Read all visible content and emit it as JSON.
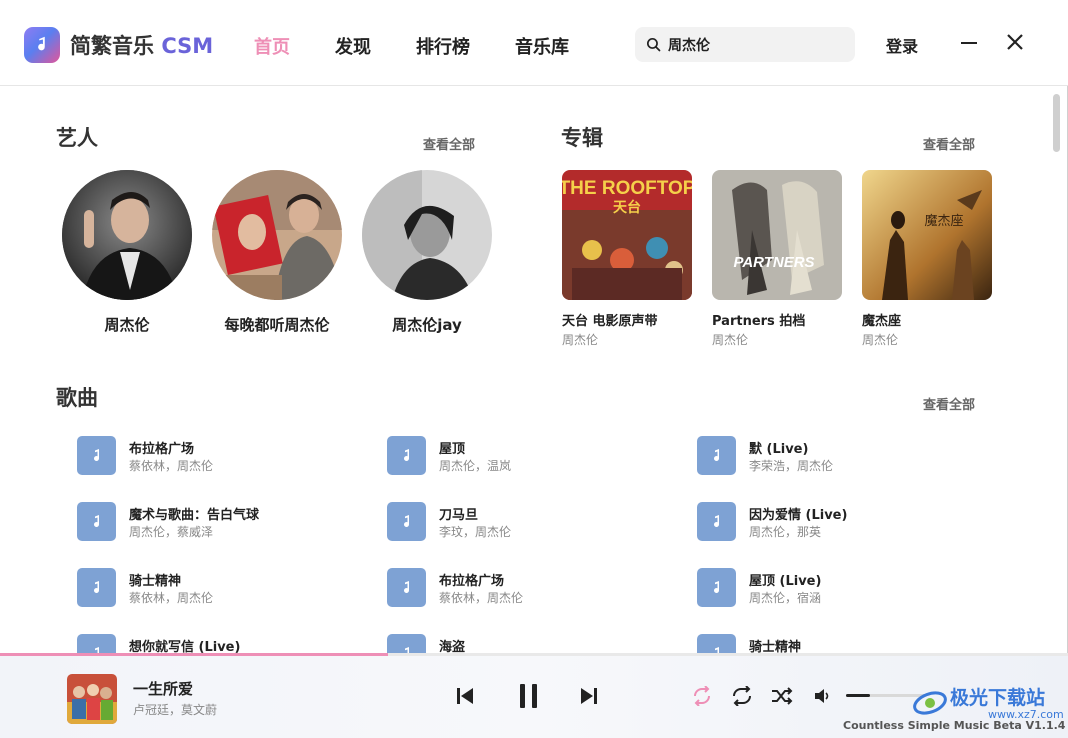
{
  "app": {
    "title_main": "简繁音乐",
    "title_suffix": "CSM"
  },
  "nav": {
    "items": [
      "首页",
      "发现",
      "排行榜",
      "音乐库"
    ],
    "active": 0
  },
  "search": {
    "value": "周杰伦",
    "icon": "search-icon"
  },
  "header": {
    "login": "登录"
  },
  "sections": {
    "artists": {
      "title": "艺人",
      "see_all": "查看全部",
      "items": [
        {
          "name": "周杰伦"
        },
        {
          "name": "每晚都听周杰伦"
        },
        {
          "name": "周杰伦jay"
        }
      ]
    },
    "albums": {
      "title": "专辑",
      "see_all": "查看全部",
      "items": [
        {
          "name": "天台 电影原声带",
          "artist": "周杰伦",
          "cover_text": "THE ROOFTOP"
        },
        {
          "name": "Partners 拍档",
          "artist": "周杰伦",
          "cover_text": "PARTNERS"
        },
        {
          "name": "魔杰座",
          "artist": "周杰伦",
          "cover_text": "魔杰座"
        }
      ]
    },
    "songs": {
      "title": "歌曲",
      "see_all": "查看全部",
      "items": [
        {
          "title": "布拉格广场",
          "artist": "蔡依林，周杰伦"
        },
        {
          "title": "屋顶",
          "artist": "周杰伦，温岚"
        },
        {
          "title": "默 (Live)",
          "artist": "李荣浩，周杰伦"
        },
        {
          "title": "魔术与歌曲：告白气球",
          "artist": "周杰伦，蔡威泽"
        },
        {
          "title": "刀马旦",
          "artist": "李玟，周杰伦"
        },
        {
          "title": "因为爱情 (Live)",
          "artist": "周杰伦，那英"
        },
        {
          "title": "骑士精神",
          "artist": "蔡依林，周杰伦"
        },
        {
          "title": "布拉格广场",
          "artist": "蔡依林，周杰伦"
        },
        {
          "title": "屋顶 (Live)",
          "artist": "周杰伦，宿涵"
        },
        {
          "title": "想你就写信 (Live)",
          "artist": ""
        },
        {
          "title": "海盗",
          "artist": ""
        },
        {
          "title": "骑士精神",
          "artist": ""
        }
      ]
    }
  },
  "player": {
    "title": "一生所爱",
    "artist": "卢冠廷，莫文蔚",
    "progress": 0.363,
    "volume": 0.3,
    "accent": "#ee8fb6",
    "icons": [
      "prev-icon",
      "pause-icon",
      "next-icon",
      "repeat-one-icon",
      "repeat-icon",
      "shuffle-icon",
      "volume-icon"
    ]
  },
  "status_text": "Countless Simple Music Beta V1.1.4",
  "watermark": {
    "brand": "极光下载站",
    "url": "www.xz7.com"
  }
}
